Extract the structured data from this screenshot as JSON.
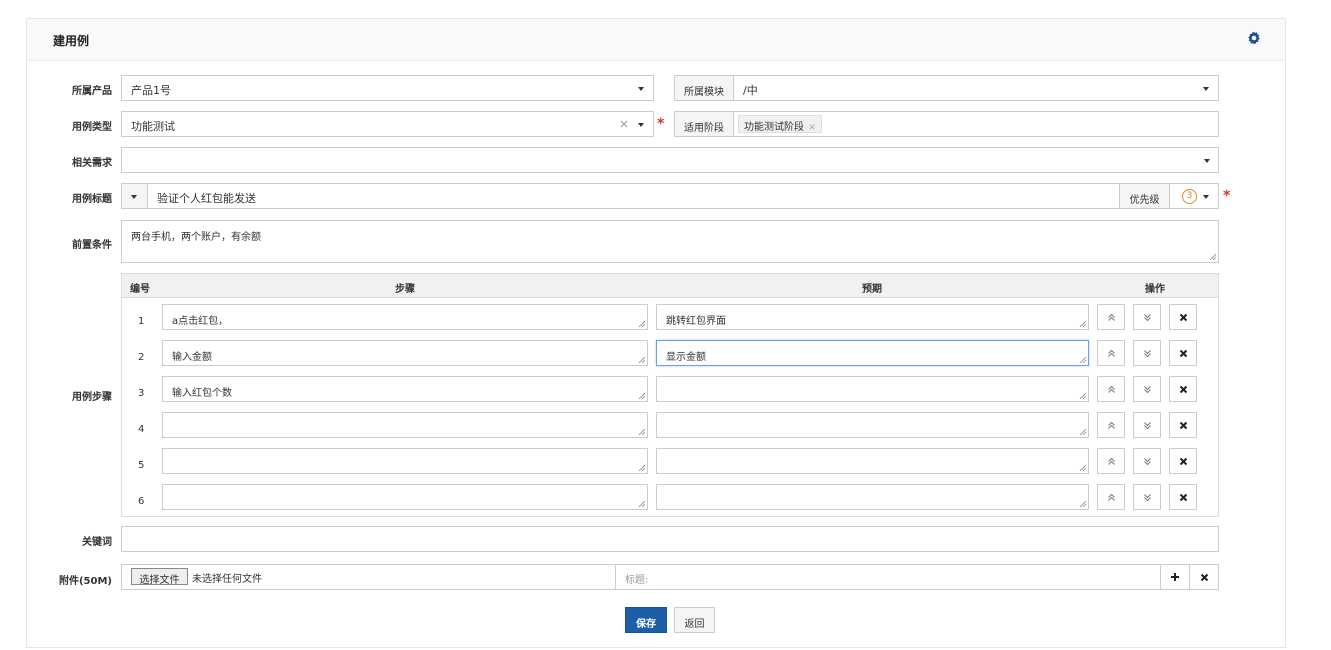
{
  "panel": {
    "title": "建用例",
    "settings_icon": "gear-icon"
  },
  "form": {
    "product": {
      "label": "所属产品",
      "value": "产品1号"
    },
    "module": {
      "label": "所属模块",
      "value": "/中"
    },
    "case_type": {
      "label": "用例类型",
      "value": "功能测试"
    },
    "stage": {
      "label": "适用阶段",
      "tags": [
        "功能测试阶段"
      ]
    },
    "story": {
      "label": "相关需求",
      "value": ""
    },
    "title": {
      "label": "用例标题",
      "value": "验证个人红包能发送"
    },
    "priority": {
      "label": "优先级",
      "value": "3"
    },
    "precondition": {
      "label": "前置条件",
      "value": "两台手机，两个账户，有余额"
    },
    "steps_label": "用例步骤",
    "steps_header": {
      "num": "编号",
      "step": "步骤",
      "expect": "预期",
      "ops": "操作"
    },
    "steps": [
      {
        "num": "1",
        "step": "a点击红包，",
        "expect": "跳转红包界面"
      },
      {
        "num": "2",
        "step": "输入金额",
        "expect": "显示金额"
      },
      {
        "num": "3",
        "step": "输入红包个数",
        "expect": ""
      },
      {
        "num": "4",
        "step": "",
        "expect": ""
      },
      {
        "num": "5",
        "step": "",
        "expect": ""
      },
      {
        "num": "6",
        "step": "",
        "expect": ""
      }
    ],
    "keywords": {
      "label": "关键词",
      "value": ""
    },
    "attachment": {
      "label": "附件(50M)",
      "choose_file": "选择文件",
      "no_file": "未选择任何文件",
      "title_placeholder": "标题:"
    }
  },
  "actions": {
    "save": "保存",
    "back": "返回"
  },
  "colors": {
    "primary": "#1e5ea8",
    "required": "#d9322c",
    "priority": "#e0882c"
  }
}
